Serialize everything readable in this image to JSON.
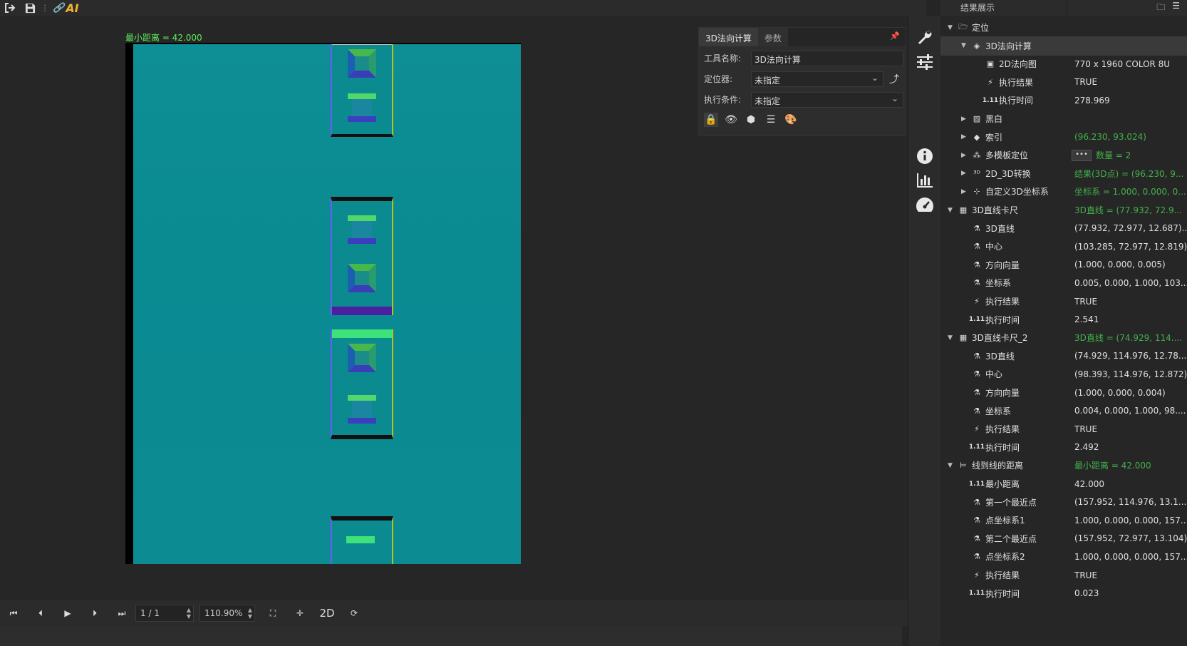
{
  "toolbar": {
    "logo_text": "AI"
  },
  "viewer": {
    "overlay_text": "最小距离 = 42.000",
    "page_indicator": "1 / 1",
    "zoom": "110.90%",
    "mode_label": "2D"
  },
  "tool_panel": {
    "tabs": [
      "3D法向计算",
      "参数"
    ],
    "fields": [
      {
        "label": "工具名称:",
        "value": "3D法向计算"
      },
      {
        "label": "定位器:",
        "value": "未指定"
      },
      {
        "label": "执行条件:",
        "value": "未指定"
      }
    ]
  },
  "results": {
    "title": "结果展示",
    "rows": [
      {
        "label": "定位",
        "value": "",
        "indent": 0,
        "arrow": "down",
        "icon": "folder-icon",
        "green": false
      },
      {
        "label": "3D法向计算",
        "value": "",
        "indent": 1,
        "arrow": "down",
        "icon": "normal-calc-icon",
        "green": false,
        "selected": true
      },
      {
        "label": "2D法向图",
        "value": "770 x 1960 COLOR 8U",
        "indent": 2,
        "arrow": "",
        "icon": "image-icon",
        "green": false
      },
      {
        "label": "执行结果",
        "value": "TRUE",
        "indent": 2,
        "arrow": "",
        "icon": "result-icon",
        "green": false
      },
      {
        "label": "执行时间",
        "value": "278.969",
        "indent": 2,
        "arrow": "",
        "icon": "number-icon",
        "green": false
      },
      {
        "label": "黑白",
        "value": "",
        "indent": 1,
        "arrow": "right",
        "icon": "bw-image-icon",
        "green": false
      },
      {
        "label": "索引",
        "value": "(96.230, 93.024)",
        "indent": 1,
        "arrow": "right",
        "icon": "layers-icon",
        "green": true
      },
      {
        "label": "多模板定位",
        "value": "数量 = 2",
        "indent": 1,
        "arrow": "right",
        "icon": "multi-template-icon",
        "green": true,
        "ellipsis": true
      },
      {
        "label": "2D_3D转换",
        "value": "结果(3D点) = (96.230, 9...",
        "indent": 1,
        "arrow": "right",
        "icon": "convert-2d3d-icon",
        "green": true
      },
      {
        "label": "自定义3D坐标系",
        "value": "坐标系 = 1.000, 0.000, 0...",
        "indent": 1,
        "arrow": "right",
        "icon": "axes-icon",
        "green": true
      },
      {
        "label": "3D直线卡尺",
        "value": "3D直线 = (77.932, 72.9...",
        "indent": 0,
        "arrow": "down",
        "icon": "caliper-icon",
        "green": true
      },
      {
        "label": "3D直线",
        "value": "(77.932, 72.977, 12.687)...",
        "indent": 1,
        "arrow": "",
        "icon": "flask-icon",
        "green": false
      },
      {
        "label": "中心",
        "value": "(103.285, 72.977, 12.819)",
        "indent": 1,
        "arrow": "",
        "icon": "flask-icon",
        "green": false
      },
      {
        "label": "方向向量",
        "value": "(1.000, 0.000, 0.005)",
        "indent": 1,
        "arrow": "",
        "icon": "flask-icon",
        "green": false
      },
      {
        "label": "坐标系",
        "value": "0.005, 0.000, 1.000, 103...",
        "indent": 1,
        "arrow": "",
        "icon": "flask-icon",
        "green": false
      },
      {
        "label": "执行结果",
        "value": "TRUE",
        "indent": 1,
        "arrow": "",
        "icon": "result-icon",
        "green": false
      },
      {
        "label": "执行时间",
        "value": "2.541",
        "indent": 1,
        "arrow": "",
        "icon": "number-icon",
        "green": false
      },
      {
        "label": "3D直线卡尺_2",
        "value": "3D直线 = (74.929, 114....",
        "indent": 0,
        "arrow": "down",
        "icon": "caliper-icon",
        "green": true
      },
      {
        "label": "3D直线",
        "value": "(74.929, 114.976, 12.78...",
        "indent": 1,
        "arrow": "",
        "icon": "flask-icon",
        "green": false
      },
      {
        "label": "中心",
        "value": "(98.393, 114.976, 12.872)",
        "indent": 1,
        "arrow": "",
        "icon": "flask-icon",
        "green": false
      },
      {
        "label": "方向向量",
        "value": "(1.000, 0.000, 0.004)",
        "indent": 1,
        "arrow": "",
        "icon": "flask-icon",
        "green": false
      },
      {
        "label": "坐标系",
        "value": "0.004, 0.000, 1.000, 98....",
        "indent": 1,
        "arrow": "",
        "icon": "flask-icon",
        "green": false
      },
      {
        "label": "执行结果",
        "value": "TRUE",
        "indent": 1,
        "arrow": "",
        "icon": "result-icon",
        "green": false
      },
      {
        "label": "执行时间",
        "value": "2.492",
        "indent": 1,
        "arrow": "",
        "icon": "number-icon",
        "green": false
      },
      {
        "label": "线到线的距离",
        "value": "最小距离 = 42.000",
        "indent": 0,
        "arrow": "down",
        "icon": "line-distance-icon",
        "green": true
      },
      {
        "label": "最小距离",
        "value": "42.000",
        "indent": 1,
        "arrow": "",
        "icon": "number-icon",
        "green": false
      },
      {
        "label": "第一个最近点",
        "value": "(157.952, 114.976, 13.1...",
        "indent": 1,
        "arrow": "",
        "icon": "flask-icon",
        "green": false
      },
      {
        "label": "点坐标系1",
        "value": "1.000, 0.000, 0.000, 157...",
        "indent": 1,
        "arrow": "",
        "icon": "flask-icon",
        "green": false
      },
      {
        "label": "第二个最近点",
        "value": "(157.952, 72.977, 13.104)",
        "indent": 1,
        "arrow": "",
        "icon": "flask-icon",
        "green": false
      },
      {
        "label": "点坐标系2",
        "value": "1.000, 0.000, 0.000, 157...",
        "indent": 1,
        "arrow": "",
        "icon": "flask-icon",
        "green": false
      },
      {
        "label": "执行结果",
        "value": "TRUE",
        "indent": 1,
        "arrow": "",
        "icon": "result-icon",
        "green": false
      },
      {
        "label": "执行时间",
        "value": "0.023",
        "indent": 1,
        "arrow": "",
        "icon": "number-icon",
        "green": false
      }
    ]
  },
  "colors": {
    "accent_green": "#43b14a",
    "overlay_green": "#5cf05c",
    "logo_orange": "#f2b233",
    "image_teal": "#0b8a90"
  }
}
